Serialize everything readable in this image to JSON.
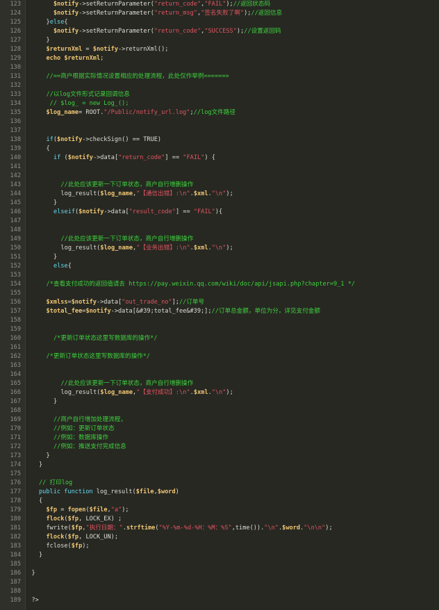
{
  "editor": {
    "language": "php",
    "colors": {
      "background": "#272822",
      "gutter": "#2f302a",
      "line_number": "#8f908a",
      "plain": "#dfdfd7",
      "variable": "#f0c674",
      "keyword": "#66d9ef",
      "string": "#e05561",
      "comment": "#3ed23e"
    },
    "lines": [
      {
        "n": "123",
        "ind": 2,
        "t": [
          [
            "var",
            "$notify"
          ],
          [
            "pl",
            "->setReturnParameter("
          ],
          [
            "str",
            "\"return_code\""
          ],
          [
            "pl",
            ","
          ],
          [
            "str",
            "\"FAIL\""
          ],
          [
            "pl",
            ");"
          ],
          [
            "cm",
            "//返回状态码"
          ]
        ]
      },
      {
        "n": "124",
        "ind": 2,
        "t": [
          [
            "var",
            "$notify"
          ],
          [
            "pl",
            "->setReturnParameter("
          ],
          [
            "str",
            "\"return_msg\""
          ],
          [
            "pl",
            ","
          ],
          [
            "str",
            "\"签名失败了啊\""
          ],
          [
            "pl",
            ");"
          ],
          [
            "cm",
            "//返回信息"
          ]
        ]
      },
      {
        "n": "125",
        "ind": 1,
        "t": [
          [
            "pl",
            "}"
          ],
          [
            "kw",
            "else"
          ],
          [
            "pl",
            "{"
          ]
        ]
      },
      {
        "n": "126",
        "ind": 2,
        "t": [
          [
            "var",
            "$notify"
          ],
          [
            "pl",
            "->setReturnParameter("
          ],
          [
            "str",
            "\"return_code\""
          ],
          [
            "pl",
            ","
          ],
          [
            "str",
            "\"SUCCESS\""
          ],
          [
            "pl",
            ");"
          ],
          [
            "cm",
            "//设置返回码"
          ]
        ]
      },
      {
        "n": "127",
        "ind": 1,
        "t": [
          [
            "pl",
            "}"
          ]
        ]
      },
      {
        "n": "128",
        "ind": 1,
        "t": [
          [
            "var",
            "$returnXml"
          ],
          [
            "pl",
            " = "
          ],
          [
            "var",
            "$notify"
          ],
          [
            "pl",
            "->returnXml();"
          ]
        ]
      },
      {
        "n": "129",
        "ind": 1,
        "t": [
          [
            "fn",
            "echo "
          ],
          [
            "var",
            "$returnXml"
          ],
          [
            "pl",
            ";"
          ]
        ]
      },
      {
        "n": "130",
        "ind": 0,
        "t": []
      },
      {
        "n": "131",
        "ind": 1,
        "t": [
          [
            "cm",
            "//==商户根据实际情况设置相应的处理流程，此处仅作举例======="
          ]
        ]
      },
      {
        "n": "132",
        "ind": 0,
        "t": []
      },
      {
        "n": "133",
        "ind": 1,
        "t": [
          [
            "cm",
            "//以log文件形式记录回调信息"
          ]
        ]
      },
      {
        "n": "134",
        "ind": 1,
        "t": [
          [
            "cm",
            " // $log_ = new Log_();"
          ]
        ]
      },
      {
        "n": "135",
        "ind": 1,
        "t": [
          [
            "var",
            "$log_name"
          ],
          [
            "pl",
            "= ROOT."
          ],
          [
            "str",
            "\"/Public/notify_url.log\""
          ],
          [
            "pl",
            ";"
          ],
          [
            "cm",
            "//log文件路径"
          ]
        ]
      },
      {
        "n": "136",
        "ind": 0,
        "t": []
      },
      {
        "n": "137",
        "ind": 0,
        "t": []
      },
      {
        "n": "138",
        "ind": 1,
        "t": [
          [
            "kw",
            "if"
          ],
          [
            "pl",
            "("
          ],
          [
            "var",
            "$notify"
          ],
          [
            "pl",
            "->checkSign() == TRUE)"
          ]
        ]
      },
      {
        "n": "139",
        "ind": 1,
        "t": [
          [
            "pl",
            "{"
          ]
        ]
      },
      {
        "n": "140",
        "ind": 2,
        "t": [
          [
            "kw",
            "if"
          ],
          [
            "pl",
            " ("
          ],
          [
            "var",
            "$notify"
          ],
          [
            "pl",
            "->data["
          ],
          [
            "str",
            "\"return_code\""
          ],
          [
            "pl",
            "] == "
          ],
          [
            "str",
            "\"FAIL\""
          ],
          [
            "pl",
            ") {"
          ]
        ]
      },
      {
        "n": "141",
        "ind": 0,
        "t": []
      },
      {
        "n": "142",
        "ind": 0,
        "t": []
      },
      {
        "n": "143",
        "ind": 3,
        "t": [
          [
            "cm",
            "//此处应该更新一下订单状态，商户自行增删操作"
          ]
        ]
      },
      {
        "n": "144",
        "ind": 3,
        "t": [
          [
            "pl",
            "log_result("
          ],
          [
            "var",
            "$log_name"
          ],
          [
            "pl",
            ","
          ],
          [
            "str",
            "\"【通信出错】:\\n\""
          ],
          [
            "pl",
            "."
          ],
          [
            "var",
            "$xml"
          ],
          [
            "pl",
            "."
          ],
          [
            "str",
            "\"\\n\""
          ],
          [
            "pl",
            ");"
          ]
        ]
      },
      {
        "n": "145",
        "ind": 2,
        "t": [
          [
            "pl",
            "}"
          ]
        ]
      },
      {
        "n": "146",
        "ind": 2,
        "t": [
          [
            "kw",
            "elseif"
          ],
          [
            "pl",
            "("
          ],
          [
            "var",
            "$notify"
          ],
          [
            "pl",
            "->data["
          ],
          [
            "str",
            "\"result_code\""
          ],
          [
            "pl",
            "] == "
          ],
          [
            "str",
            "\"FAIL\""
          ],
          [
            "pl",
            "){"
          ]
        ]
      },
      {
        "n": "147",
        "ind": 0,
        "t": []
      },
      {
        "n": "148",
        "ind": 0,
        "t": []
      },
      {
        "n": "149",
        "ind": 3,
        "t": [
          [
            "cm",
            "//此处应该更新一下订单状态，商户自行增删操作"
          ]
        ]
      },
      {
        "n": "150",
        "ind": 3,
        "t": [
          [
            "pl",
            "log_result("
          ],
          [
            "var",
            "$log_name"
          ],
          [
            "pl",
            ","
          ],
          [
            "str",
            "\"【业务出错】:\\n\""
          ],
          [
            "pl",
            "."
          ],
          [
            "var",
            "$xml"
          ],
          [
            "pl",
            "."
          ],
          [
            "str",
            "\"\\n\""
          ],
          [
            "pl",
            ");"
          ]
        ]
      },
      {
        "n": "151",
        "ind": 2,
        "t": [
          [
            "pl",
            "}"
          ]
        ]
      },
      {
        "n": "152",
        "ind": 2,
        "t": [
          [
            "kw",
            "else"
          ],
          [
            "pl",
            "{"
          ]
        ]
      },
      {
        "n": "153",
        "ind": 0,
        "t": []
      },
      {
        "n": "154",
        "ind": 1,
        "t": [
          [
            "cm",
            "/*查看支付成功的返回值请去 https://pay.weixin.qq.com/wiki/doc/api/jsapi.php?chapter=9_1 */"
          ]
        ]
      },
      {
        "n": "155",
        "ind": 0,
        "t": []
      },
      {
        "n": "156",
        "ind": 1,
        "t": [
          [
            "var",
            "$xmlss"
          ],
          [
            "pl",
            "="
          ],
          [
            "var",
            "$notify"
          ],
          [
            "pl",
            "->data["
          ],
          [
            "str",
            "\"out_trade_no\""
          ],
          [
            "pl",
            "];"
          ],
          [
            "cm",
            "//订单号"
          ]
        ]
      },
      {
        "n": "157",
        "ind": 1,
        "t": [
          [
            "var",
            "$total_fee"
          ],
          [
            "pl",
            "="
          ],
          [
            "var",
            "$notify"
          ],
          [
            "pl",
            "->data[&#39;total_fee&#39;];"
          ],
          [
            "cm",
            "//订单总金额，单位为分，详见支付金额"
          ]
        ]
      },
      {
        "n": "158",
        "ind": 0,
        "t": []
      },
      {
        "n": "159",
        "ind": 0,
        "t": []
      },
      {
        "n": "160",
        "ind": 2,
        "t": [
          [
            "cm",
            "/*更新订单状态这里写数据库的操作*/"
          ]
        ]
      },
      {
        "n": "161",
        "ind": 0,
        "t": []
      },
      {
        "n": "162",
        "ind": 1,
        "t": [
          [
            "cm",
            "/*更新订单状态这里写数据库的操作*/"
          ]
        ]
      },
      {
        "n": "163",
        "ind": 0,
        "t": []
      },
      {
        "n": "164",
        "ind": 0,
        "t": []
      },
      {
        "n": "165",
        "ind": 3,
        "t": [
          [
            "cm",
            "//此处应该更新一下订单状态，商户自行增删操作"
          ]
        ]
      },
      {
        "n": "166",
        "ind": 3,
        "t": [
          [
            "pl",
            "log_result("
          ],
          [
            "var",
            "$log_name"
          ],
          [
            "pl",
            ","
          ],
          [
            "str",
            "\"【支付成功】:\\n\""
          ],
          [
            "pl",
            "."
          ],
          [
            "var",
            "$xml"
          ],
          [
            "pl",
            "."
          ],
          [
            "str",
            "\"\\n\""
          ],
          [
            "pl",
            ");"
          ]
        ]
      },
      {
        "n": "167",
        "ind": 2,
        "t": [
          [
            "pl",
            "}"
          ]
        ]
      },
      {
        "n": "168",
        "ind": 0,
        "t": []
      },
      {
        "n": "169",
        "ind": 2,
        "t": [
          [
            "cm",
            "//商户自行增加处理流程,"
          ]
        ]
      },
      {
        "n": "170",
        "ind": 2,
        "t": [
          [
            "cm",
            "//例如：更新订单状态"
          ]
        ]
      },
      {
        "n": "171",
        "ind": 2,
        "t": [
          [
            "cm",
            "//例如：数据库操作"
          ]
        ]
      },
      {
        "n": "172",
        "ind": 2,
        "t": [
          [
            "cm",
            "//例如：推送支付完成信息"
          ]
        ]
      },
      {
        "n": "173",
        "ind": 1,
        "t": [
          [
            "pl",
            "}"
          ]
        ]
      },
      {
        "n": "174",
        "ind": 0,
        "t": [
          [
            "pl",
            "}"
          ]
        ]
      },
      {
        "n": "175",
        "ind": 0,
        "t": []
      },
      {
        "n": "176",
        "ind": 0,
        "t": [
          [
            "cm",
            "// 打印log"
          ]
        ]
      },
      {
        "n": "177",
        "ind": 0,
        "t": [
          [
            "kw",
            "public function"
          ],
          [
            "pl",
            " log_result("
          ],
          [
            "var",
            "$file"
          ],
          [
            "pl",
            ","
          ],
          [
            "var",
            "$word"
          ],
          [
            "pl",
            ")"
          ]
        ]
      },
      {
        "n": "178",
        "ind": 0,
        "t": [
          [
            "pl",
            "{"
          ]
        ]
      },
      {
        "n": "179",
        "ind": 1,
        "t": [
          [
            "var",
            "$fp"
          ],
          [
            "pl",
            " = "
          ],
          [
            "fn",
            "fopen"
          ],
          [
            "pl",
            "("
          ],
          [
            "var",
            "$file"
          ],
          [
            "pl",
            ","
          ],
          [
            "str",
            "\"a\""
          ],
          [
            "pl",
            ");"
          ]
        ]
      },
      {
        "n": "180",
        "ind": 1,
        "t": [
          [
            "fn",
            "flock"
          ],
          [
            "pl",
            "("
          ],
          [
            "var",
            "$fp"
          ],
          [
            "pl",
            ", LOCK_EX) ;"
          ]
        ]
      },
      {
        "n": "181",
        "ind": 1,
        "t": [
          [
            "pl",
            "fwrite("
          ],
          [
            "var",
            "$fp"
          ],
          [
            "pl",
            ","
          ],
          [
            "str",
            "\"执行日期：\""
          ],
          [
            "pl",
            "."
          ],
          [
            "fn",
            "strftime"
          ],
          [
            "pl",
            "("
          ],
          [
            "str",
            "\"%Y-%m-%d-%H：%M：%S\""
          ],
          [
            "pl",
            ",time())."
          ],
          [
            "str",
            "\"\\n\""
          ],
          [
            "pl",
            "."
          ],
          [
            "var",
            "$word"
          ],
          [
            "pl",
            "."
          ],
          [
            "str",
            "\"\\n\\n\""
          ],
          [
            "pl",
            ");"
          ]
        ]
      },
      {
        "n": "182",
        "ind": 1,
        "t": [
          [
            "fn",
            "flock"
          ],
          [
            "pl",
            "("
          ],
          [
            "var",
            "$fp"
          ],
          [
            "pl",
            ", LOCK_UN);"
          ]
        ]
      },
      {
        "n": "183",
        "ind": 1,
        "t": [
          [
            "pl",
            "fclose("
          ],
          [
            "var",
            "$fp"
          ],
          [
            "pl",
            ");"
          ]
        ]
      },
      {
        "n": "184",
        "ind": 0,
        "t": [
          [
            "pl",
            "}"
          ]
        ]
      },
      {
        "n": "185",
        "ind": 0,
        "t": []
      },
      {
        "n": "186",
        "ind": -1,
        "t": [
          [
            "pl",
            "}"
          ]
        ]
      },
      {
        "n": "187",
        "ind": 0,
        "t": []
      },
      {
        "n": "188",
        "ind": 0,
        "t": []
      },
      {
        "n": "189",
        "ind": -1,
        "t": [
          [
            "pl",
            "?>"
          ]
        ]
      }
    ]
  }
}
